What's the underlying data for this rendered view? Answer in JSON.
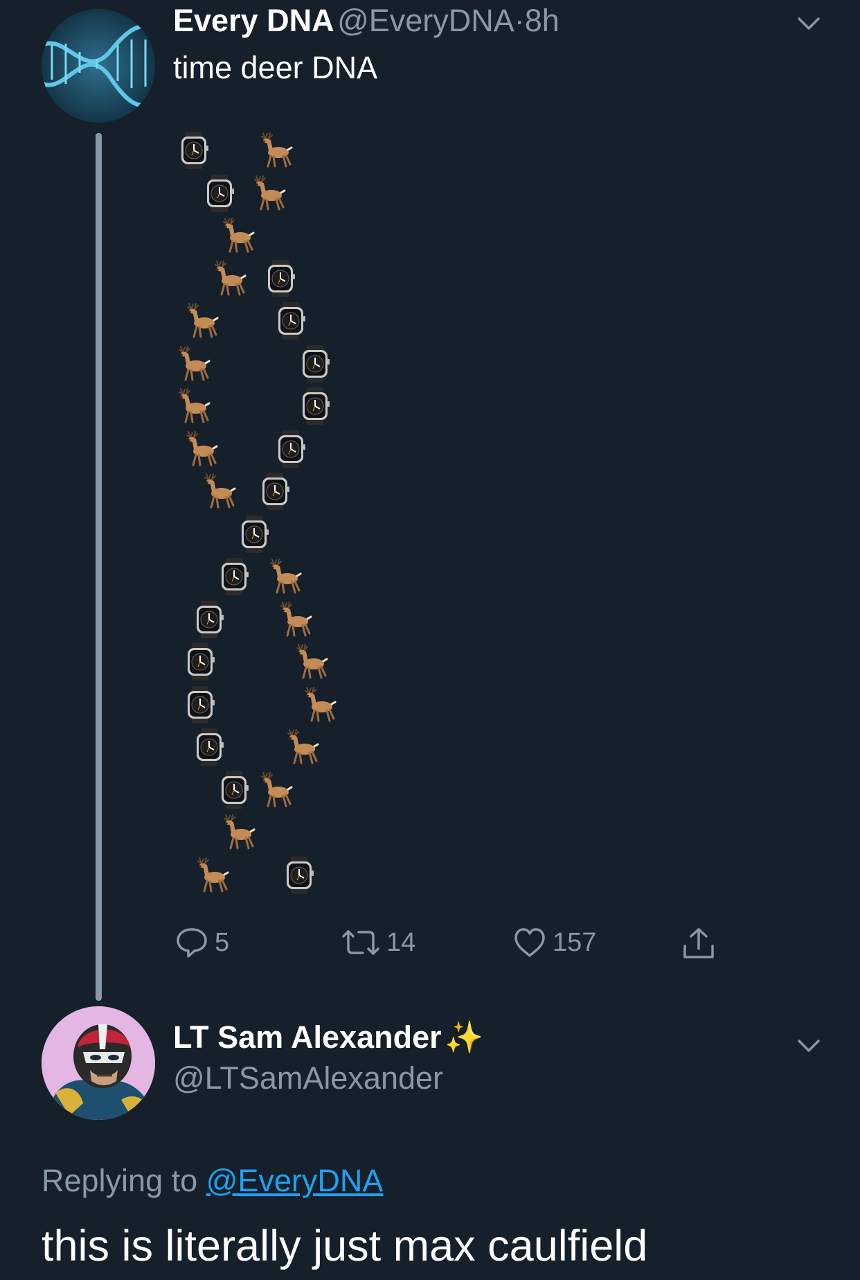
{
  "tweet": {
    "author_name": "Every DNA",
    "author_handle": "@EveryDNA",
    "separator": "·",
    "time": "8h",
    "text": "time deer DNA",
    "avatar_icon": "dna-helix-icon",
    "emoji_helix": [
      [
        "watch",
        "deer"
      ],
      [
        "watch",
        "deer"
      ],
      [
        "deer"
      ],
      [
        "deer",
        "watch"
      ],
      [
        "deer",
        "watch"
      ],
      [
        "deer",
        "watch"
      ],
      [
        "deer",
        "watch"
      ],
      [
        "deer",
        "watch"
      ],
      [
        "deer",
        "watch"
      ],
      [
        "watch"
      ],
      [
        "watch",
        "deer"
      ],
      [
        "watch",
        "deer"
      ],
      [
        "watch",
        "deer"
      ],
      [
        "watch",
        "deer"
      ],
      [
        "watch",
        "deer"
      ],
      [
        "watch",
        "deer"
      ],
      [
        "deer"
      ],
      [
        "deer",
        "watch"
      ]
    ],
    "actions": {
      "reply_count": "5",
      "retweet_count": "14",
      "like_count": "157"
    }
  },
  "reply": {
    "author_name": "LT Sam Alexander",
    "name_emoji": "✨",
    "author_handle": "@LTSamAlexander",
    "replying_label": "Replying to",
    "replying_handle": "@EveryDNA",
    "text": "this is literally just max caulfield",
    "avatar_icon": "superhero-avatar-icon"
  },
  "colors": {
    "background": "#15202b",
    "secondary_text": "#8899a6",
    "link": "#1da1f2"
  }
}
